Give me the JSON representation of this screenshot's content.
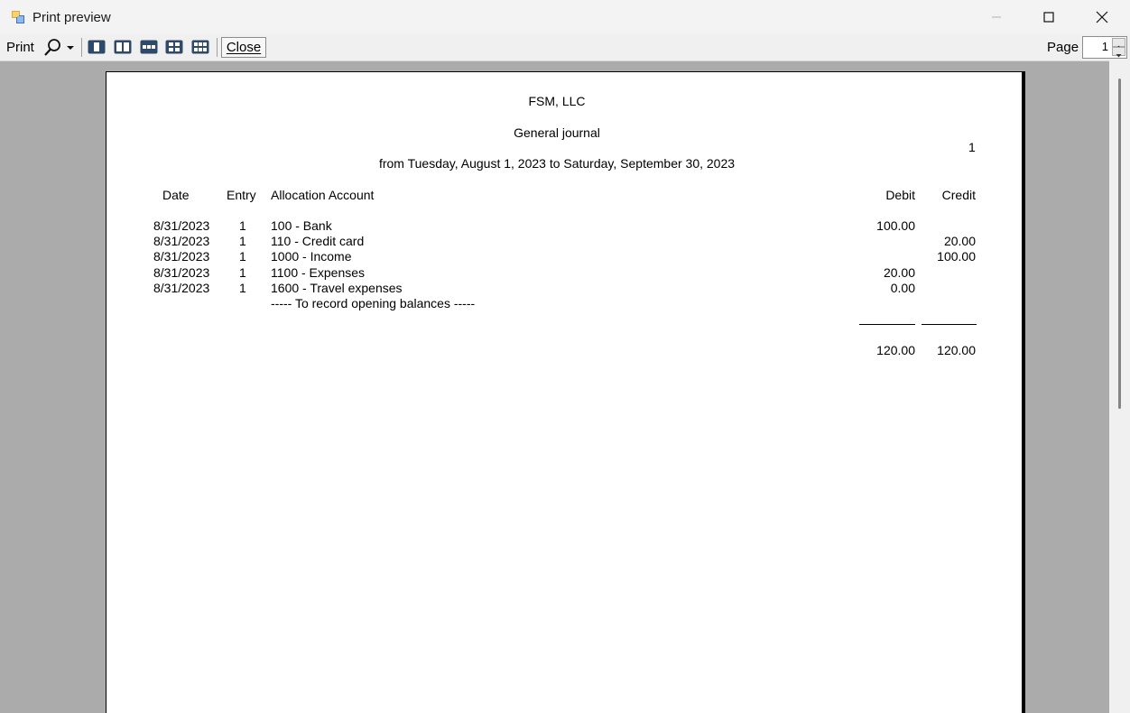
{
  "window": {
    "title": "Print preview",
    "minimize_icon": "minimize-icon",
    "maximize_icon": "maximize-icon",
    "close_icon": "close-icon"
  },
  "toolbar": {
    "print_label": "Print",
    "zoom_icon": "magnifier-icon",
    "layouts": [
      "one-page-icon",
      "two-pages-icon",
      "three-pages-icon",
      "four-pages-icon",
      "six-pages-icon"
    ],
    "close_label": "Close",
    "page_label": "Page",
    "page_value": "1"
  },
  "report": {
    "company": "FSM, LLC",
    "title": "General journal",
    "page_number": "1",
    "range": "from  Tuesday, August 1, 2023  to  Saturday, September 30, 2023",
    "headers": {
      "date": "Date",
      "entry": "Entry",
      "account": "Allocation Account",
      "debit": "Debit",
      "credit": "Credit"
    },
    "rows": [
      {
        "date": "8/31/2023",
        "entry": "1",
        "account": "100 - Bank",
        "debit": "100.00",
        "credit": ""
      },
      {
        "date": "8/31/2023",
        "entry": "1",
        "account": "110 - Credit card",
        "debit": "",
        "credit": "20.00"
      },
      {
        "date": "8/31/2023",
        "entry": "1",
        "account": "1000 - Income",
        "debit": "",
        "credit": "100.00"
      },
      {
        "date": "8/31/2023",
        "entry": "1",
        "account": "1100 - Expenses",
        "debit": "20.00",
        "credit": ""
      },
      {
        "date": "8/31/2023",
        "entry": "1",
        "account": "1600 - Travel expenses",
        "debit": "0.00",
        "credit": ""
      }
    ],
    "memo": "----- To record opening balances -----",
    "total_debit": "120.00",
    "total_credit": "120.00"
  },
  "colors": {
    "window_bg": "#ababab",
    "toolbar_bg": "#f0f0f0",
    "paper": "#ffffff"
  }
}
